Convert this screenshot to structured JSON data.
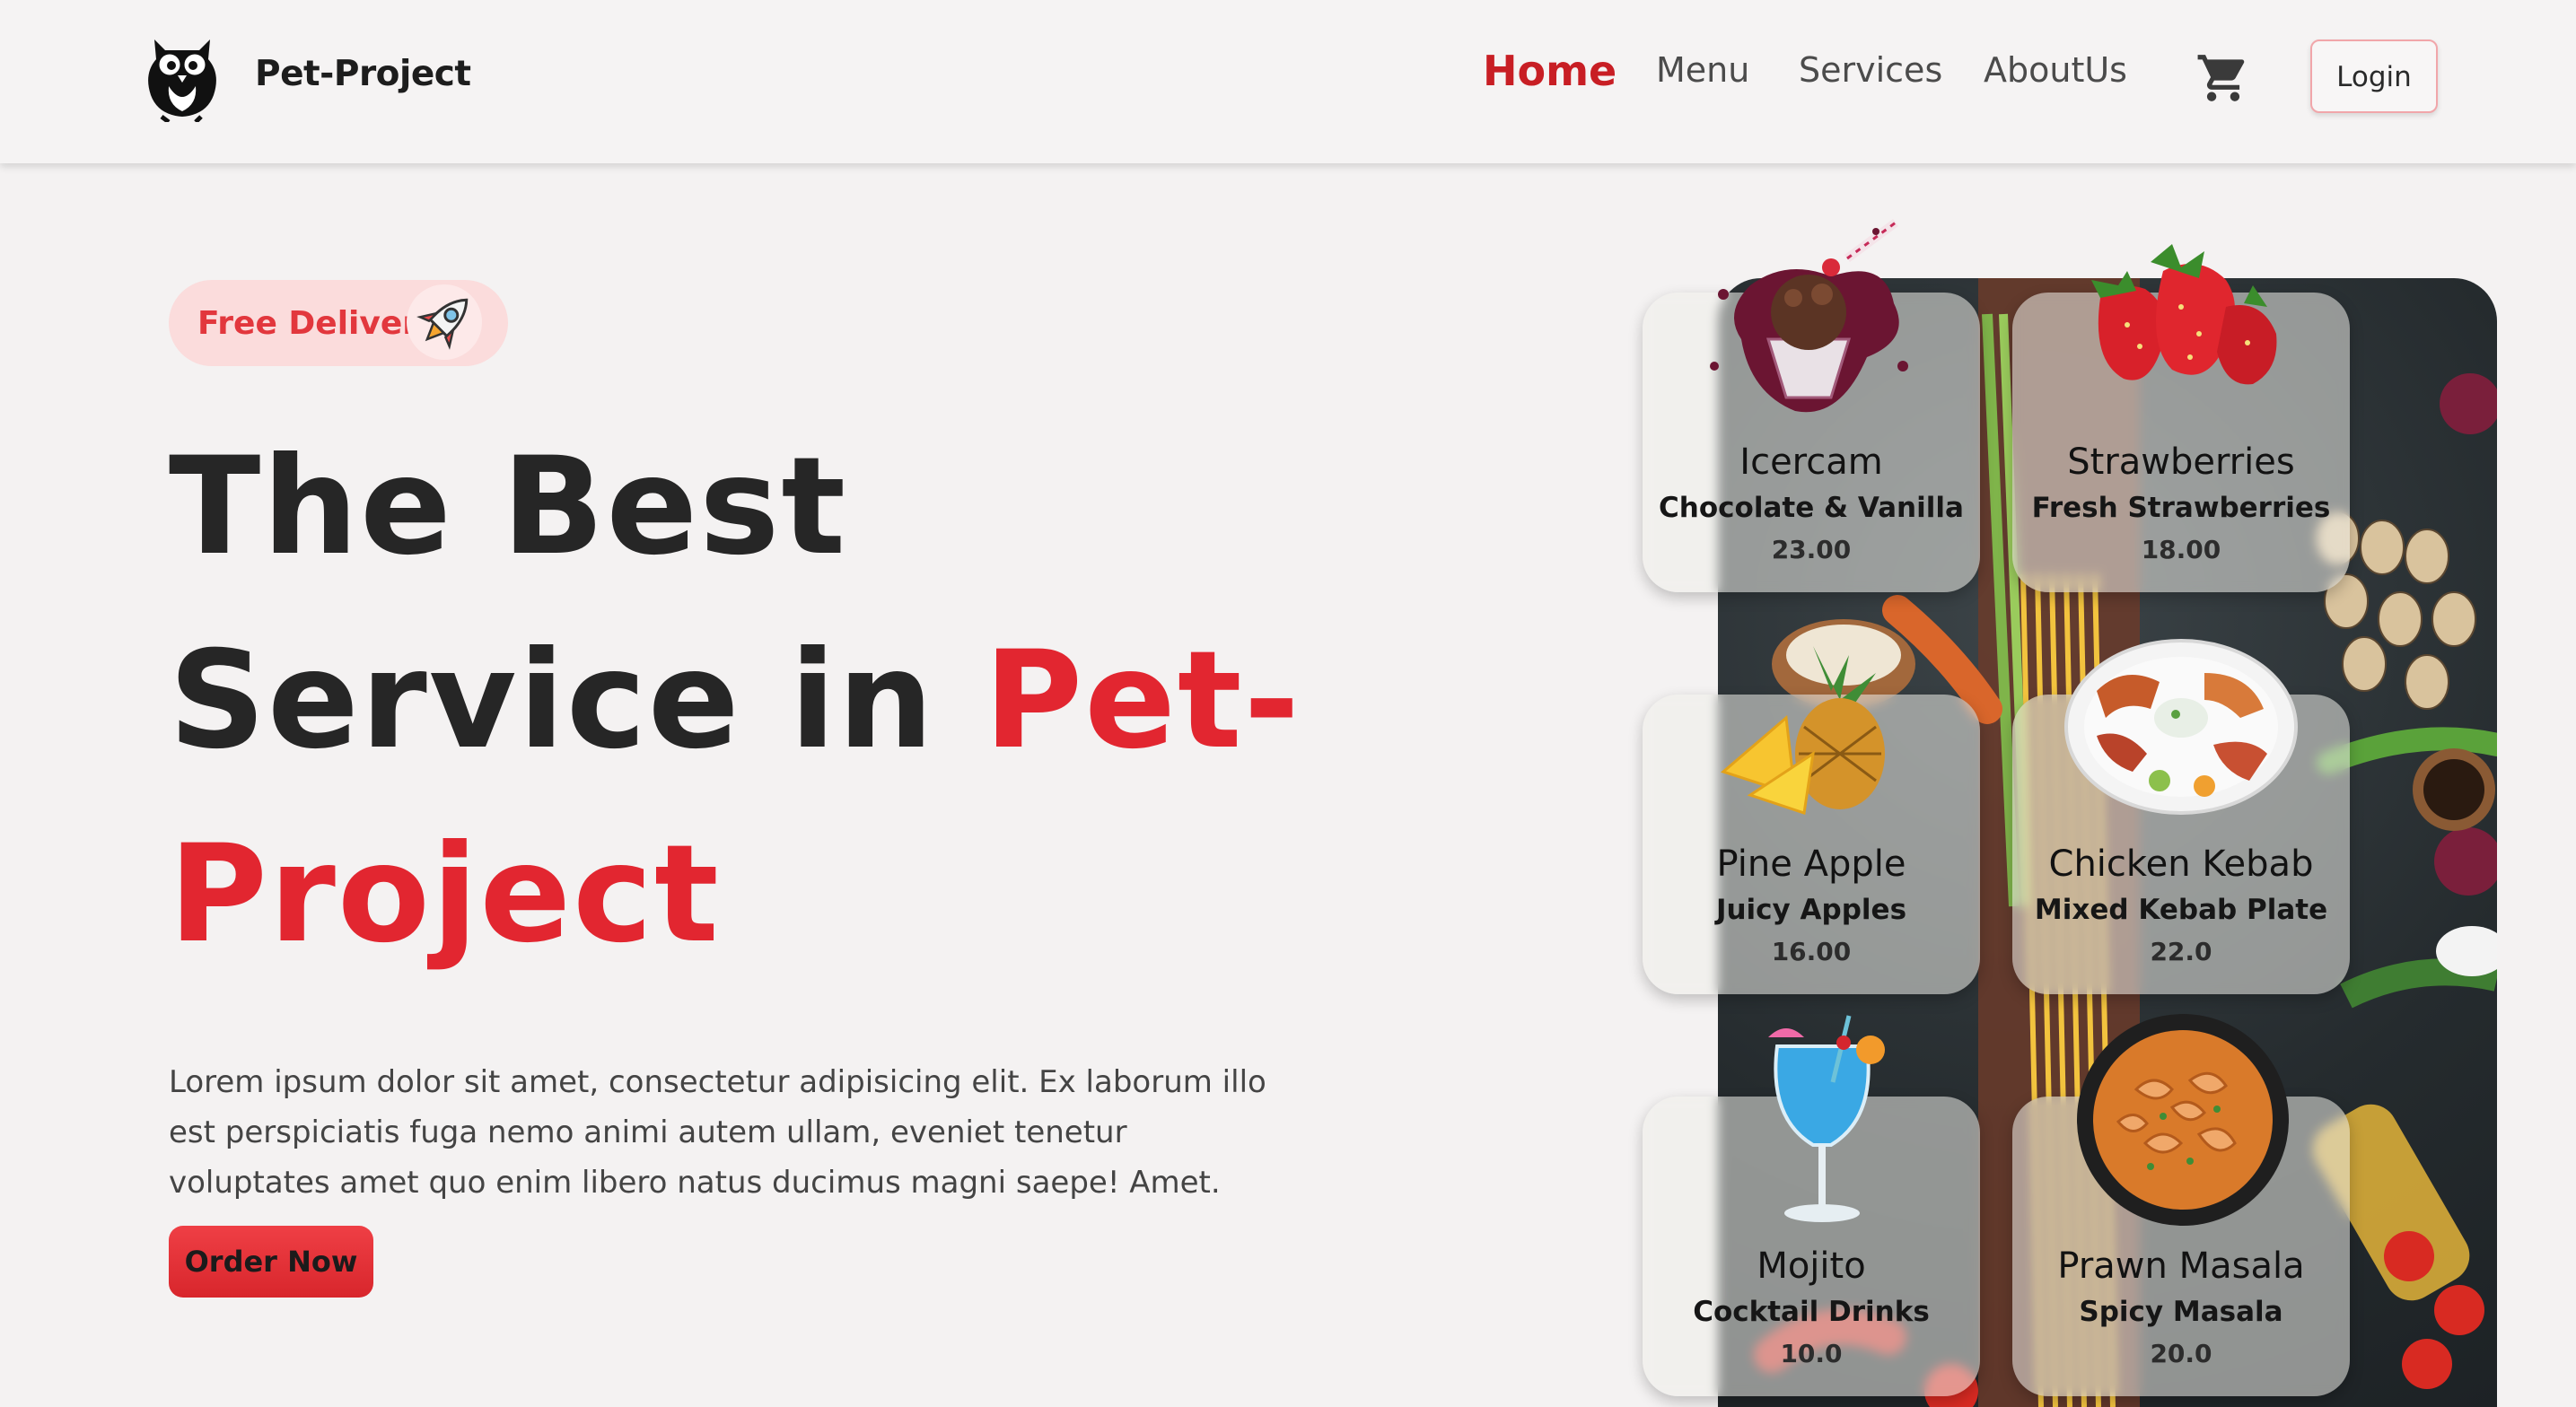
{
  "header": {
    "brand": "Pet-Project",
    "nav": [
      "Home",
      "Menu",
      "Services",
      "AboutUs"
    ],
    "login_label": "Login"
  },
  "hero": {
    "badge": "Free Delivery",
    "title_line1": "The Best",
    "title_line2_prefix": "Service in ",
    "title_line2_accent": "Pet-",
    "title_line3_accent": "Project",
    "description": "Lorem ipsum dolor sit amet, consectetur adipisicing elit. Ex laborum illo est perspiciatis fuga nemo animi autem ullam, eveniet tenetur voluptates amet quo enim libero natus ducimus magni saepe! Amet.",
    "cta": "Order Now"
  },
  "menu_cards": [
    {
      "name": "Icercam",
      "description": "Chocolate & Vanilla",
      "price": "23.00",
      "icon": "icecream-icon"
    },
    {
      "name": "Strawberries",
      "description": "Fresh Strawberries",
      "price": "18.00",
      "icon": "strawberry-icon"
    },
    {
      "name": "Pine Apple",
      "description": "Juicy Apples",
      "price": "16.00",
      "icon": "pineapple-icon"
    },
    {
      "name": "Chicken Kebab",
      "description": "Mixed Kebab Plate",
      "price": "22.0",
      "icon": "kebab-plate-icon"
    },
    {
      "name": "Mojito",
      "description": "Cocktail Drinks",
      "price": "10.0",
      "icon": "cocktail-icon"
    },
    {
      "name": "Prawn Masala",
      "description": "Spicy Masala",
      "price": "20.0",
      "icon": "curry-bowl-icon"
    }
  ],
  "colors": {
    "accent": "#e22630",
    "nav_active": "#c81e24",
    "background": "#f4f2f2",
    "pill_bg": "#fbdcdc"
  }
}
